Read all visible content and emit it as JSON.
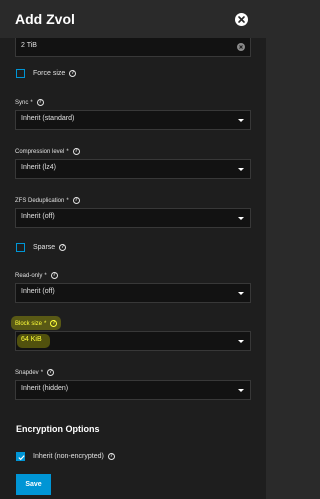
{
  "dialog": {
    "title": "Add Zvol",
    "close_icon": "close-circle-icon"
  },
  "size_field": {
    "value": "2 TiB",
    "clear_icon": "clear-icon"
  },
  "force_size": {
    "label": "Force size",
    "checked": false
  },
  "sync": {
    "label": "Sync",
    "required": "*",
    "value": "Inherit (standard)"
  },
  "compression": {
    "label": "Compression level",
    "required": "*",
    "value": "Inherit (lz4)"
  },
  "dedup": {
    "label": "ZFS Deduplication",
    "required": "*",
    "value": "Inherit (off)"
  },
  "sparse": {
    "label": "Sparse",
    "checked": false
  },
  "readonly": {
    "label": "Read-only",
    "required": "*",
    "value": "Inherit (off)"
  },
  "block_size": {
    "label": "Block size",
    "required": "*",
    "value": "64 KiB",
    "highlight_color": "#ffff3a"
  },
  "snapdev": {
    "label": "Snapdev",
    "required": "*",
    "value": "Inherit (hidden)"
  },
  "encryption": {
    "section_title": "Encryption Options",
    "inherit_label": "Inherit (non-encrypted)",
    "inherit_checked": true
  },
  "save_label": "Save",
  "help_glyph": "?",
  "colors": {
    "accent": "#0095d5",
    "background": "#1e1e1e",
    "field": "#121212"
  }
}
